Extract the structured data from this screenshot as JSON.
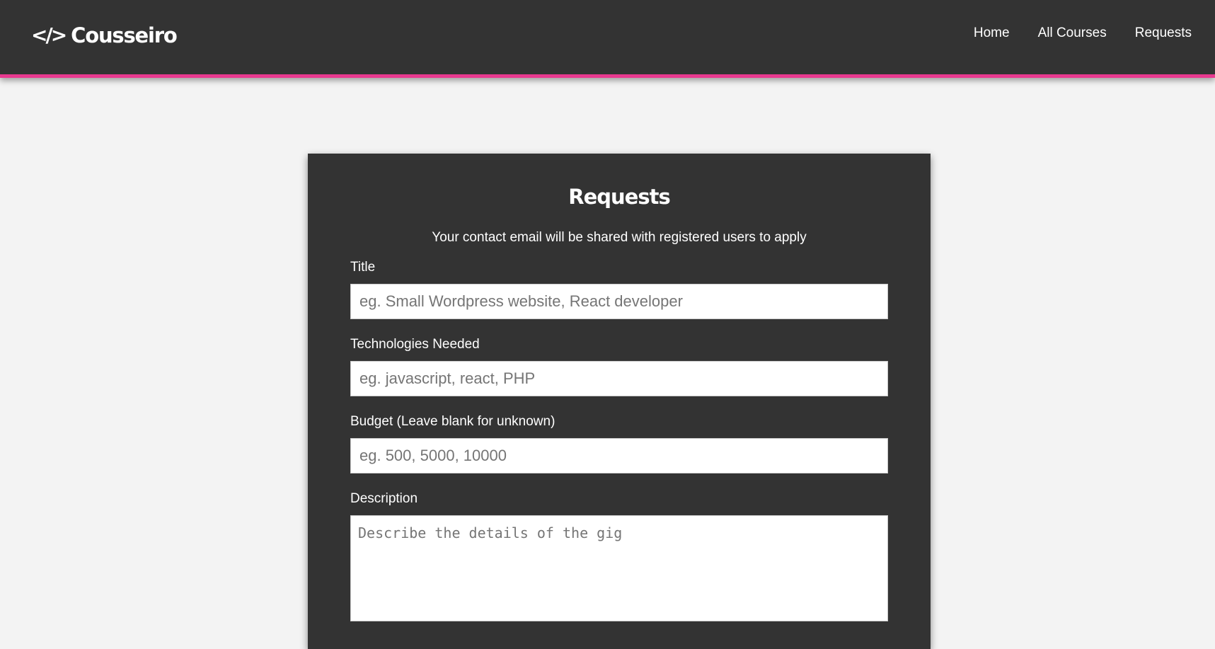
{
  "navbar": {
    "brand_icon": "</>",
    "brand_name": "Cousseiro",
    "links": [
      {
        "label": "Home"
      },
      {
        "label": "All Courses"
      },
      {
        "label": "Requests"
      }
    ],
    "accent_color": "#e8398f",
    "background_color": "#333333"
  },
  "form": {
    "title": "Requests",
    "subtitle": "Your contact email will be shared with registered users to apply",
    "fields": [
      {
        "label": "Title",
        "placeholder": "eg. Small Wordpress website, React developer",
        "value": ""
      },
      {
        "label": "Technologies Needed",
        "placeholder": "eg. javascript, react, PHP",
        "value": ""
      },
      {
        "label": "Budget (Leave blank for unknown)",
        "placeholder": "eg. 500, 5000, 10000",
        "value": ""
      },
      {
        "label": "Description",
        "placeholder": "Describe the details of the gig",
        "value": ""
      }
    ]
  },
  "icons": {
    "brand_logo": "code-slash-icon"
  }
}
